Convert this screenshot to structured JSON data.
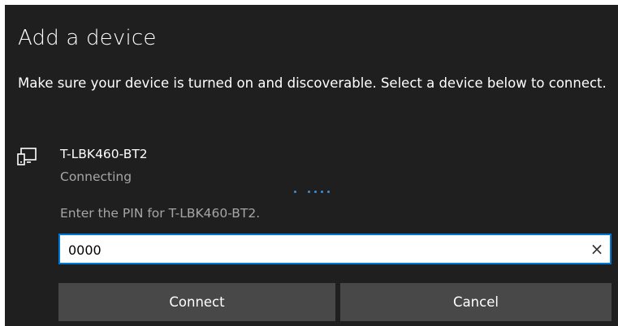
{
  "dialog": {
    "title": "Add a device",
    "instructions": "Make sure your device is turned on and discoverable. Select a device below to connect."
  },
  "device": {
    "icon": "device-icon",
    "name": "T-LBK460-BT2",
    "status": "Connecting",
    "pin_prompt": "Enter the PIN for T-LBK460-BT2."
  },
  "pin_input": {
    "value": "0000",
    "clear_icon": "×"
  },
  "buttons": {
    "connect_label": "Connect",
    "cancel_label": "Cancel"
  },
  "colors": {
    "dialog_background": "#1f1f1f",
    "accent": "#0078d7",
    "button_background": "#484848",
    "secondary_text": "#a6a6a6",
    "progress_dots": "#3b8fd9"
  }
}
